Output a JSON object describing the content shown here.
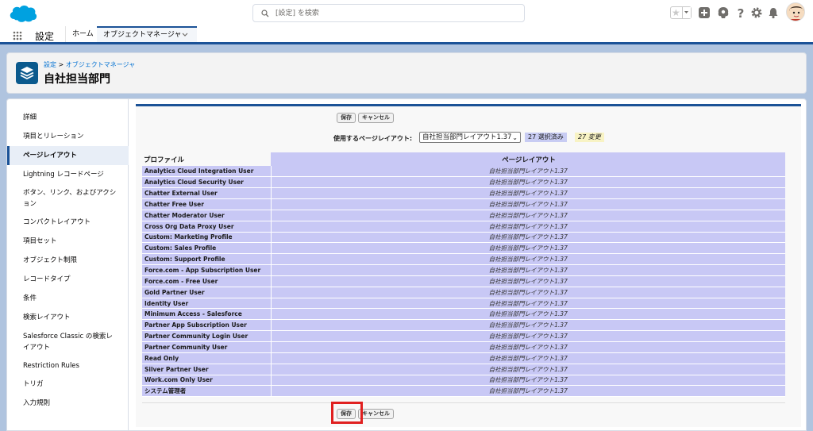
{
  "search": {
    "placeholder": "[設定] を検索"
  },
  "app": {
    "name": "設定"
  },
  "tabs": {
    "home": "ホーム",
    "object_manager": "オブジェクトマネージャ"
  },
  "breadcrumb": {
    "root": "設定",
    "separator": " > ",
    "current": "オブジェクトマネージャ"
  },
  "page_title": "自社担当部門",
  "sidebar": {
    "items": [
      {
        "label": "詳細",
        "active": false
      },
      {
        "label": "項目とリレーション",
        "active": false
      },
      {
        "label": "ページレイアウト",
        "active": true
      },
      {
        "label": "Lightning レコードページ",
        "active": false
      },
      {
        "label": "ボタン、リンク、およびアクション",
        "active": false
      },
      {
        "label": "コンパクトレイアウト",
        "active": false
      },
      {
        "label": "項目セット",
        "active": false
      },
      {
        "label": "オブジェクト制限",
        "active": false
      },
      {
        "label": "レコードタイプ",
        "active": false
      },
      {
        "label": "条件",
        "active": false
      },
      {
        "label": "検索レイアウト",
        "active": false
      },
      {
        "label": "Salesforce Classic の検索レイアウト",
        "active": false
      },
      {
        "label": "Restriction Rules",
        "active": false
      },
      {
        "label": "トリガ",
        "active": false
      },
      {
        "label": "入力規則",
        "active": false
      }
    ]
  },
  "toolbar": {
    "save_label": "保存",
    "cancel_label": "キャンセル"
  },
  "layout_selector": {
    "label": "使用するページレイアウト:",
    "selected": "自社担当部門レイアウト1.37",
    "selected_count": "27 選択済み",
    "changed_count": "27 変更"
  },
  "table": {
    "headers": {
      "profile": "プロファイル",
      "layout": "ページレイアウト"
    },
    "rows": [
      {
        "profile": "Analytics Cloud Integration User",
        "layout": "自社担当部門レイアウト1.37"
      },
      {
        "profile": "Analytics Cloud Security User",
        "layout": "自社担当部門レイアウト1.37"
      },
      {
        "profile": "Chatter External User",
        "layout": "自社担当部門レイアウト1.37"
      },
      {
        "profile": "Chatter Free User",
        "layout": "自社担当部門レイアウト1.37"
      },
      {
        "profile": "Chatter Moderator User",
        "layout": "自社担当部門レイアウト1.37"
      },
      {
        "profile": "Cross Org Data Proxy User",
        "layout": "自社担当部門レイアウト1.37"
      },
      {
        "profile": "Custom: Marketing Profile",
        "layout": "自社担当部門レイアウト1.37"
      },
      {
        "profile": "Custom: Sales Profile",
        "layout": "自社担当部門レイアウト1.37"
      },
      {
        "profile": "Custom: Support Profile",
        "layout": "自社担当部門レイアウト1.37"
      },
      {
        "profile": "Force.com - App Subscription User",
        "layout": "自社担当部門レイアウト1.37"
      },
      {
        "profile": "Force.com - Free User",
        "layout": "自社担当部門レイアウト1.37"
      },
      {
        "profile": "Gold Partner User",
        "layout": "自社担当部門レイアウト1.37"
      },
      {
        "profile": "Identity User",
        "layout": "自社担当部門レイアウト1.37"
      },
      {
        "profile": "Minimum Access - Salesforce",
        "layout": "自社担当部門レイアウト1.37"
      },
      {
        "profile": "Partner App Subscription User",
        "layout": "自社担当部門レイアウト1.37"
      },
      {
        "profile": "Partner Community Login User",
        "layout": "自社担当部門レイアウト1.37"
      },
      {
        "profile": "Partner Community User",
        "layout": "自社担当部門レイアウト1.37"
      },
      {
        "profile": "Read Only",
        "layout": "自社担当部門レイアウト1.37"
      },
      {
        "profile": "Silver Partner User",
        "layout": "自社担当部門レイアウト1.37"
      },
      {
        "profile": "Work.com Only User",
        "layout": "自社担当部門レイアウト1.37"
      },
      {
        "profile": "システム管理者",
        "layout": "自社担当部門レイアウト1.37"
      }
    ]
  },
  "colors": {
    "brand_blue": "#1b5297",
    "table_fill": "#c8c8f5",
    "changed_badge": "#f8f3c4",
    "highlight": "#e02020"
  }
}
